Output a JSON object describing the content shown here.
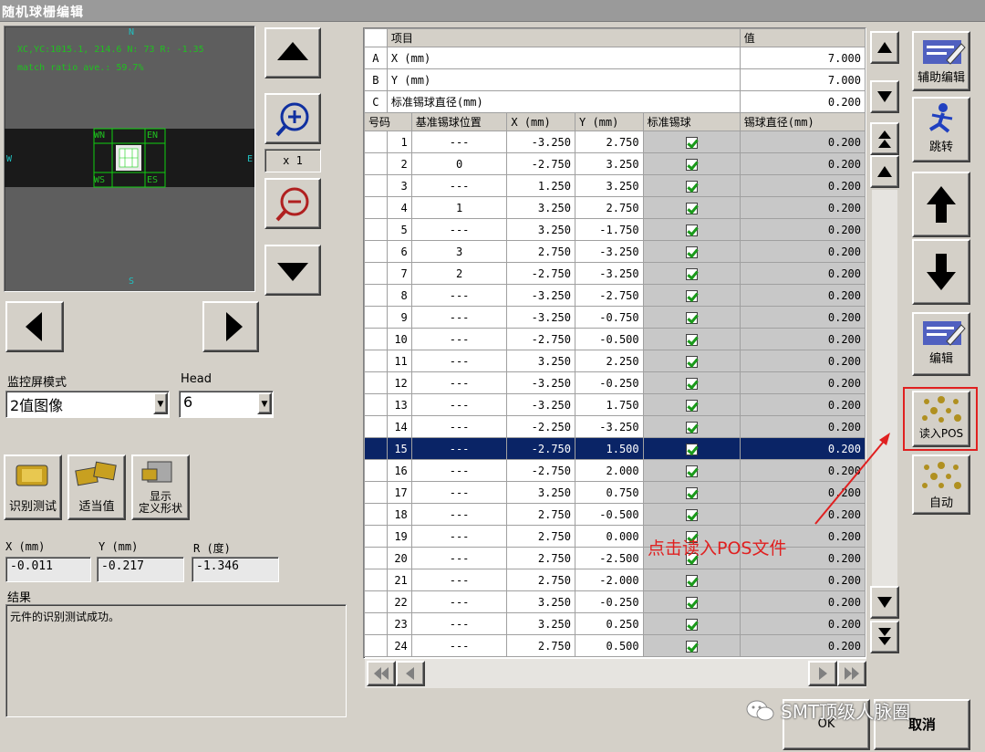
{
  "window": {
    "title": "随机球栅编辑"
  },
  "camera": {
    "info_line": "XC,YC:1015.1, 214.6 N: 73  R: -1.35",
    "match_line": "match ratio ave.: 59.7%",
    "north": "N",
    "south": "S",
    "west": "W",
    "east": "E",
    "tag_wn": "WN",
    "tag_en": "EN",
    "tag_ws": "WS",
    "tag_es": "ES"
  },
  "zoom": {
    "level": "x 1"
  },
  "monitor_mode": {
    "label": "监控屏模式",
    "value": "2值图像"
  },
  "head": {
    "label": "Head",
    "value": "6"
  },
  "tools": {
    "recognize_test": "识别测试",
    "fit_value": "适当值",
    "show_shape_line1": "显示",
    "show_shape_line2": "定义形状"
  },
  "offset": {
    "x_label": "X (mm)",
    "x_value": "-0.011",
    "y_label": "Y (mm)",
    "y_value": "-0.217",
    "r_label": "R (度)",
    "r_value": "-1.346"
  },
  "result": {
    "label": "结果",
    "text": "元件的识别测试成功。"
  },
  "params": {
    "header_item": "项目",
    "header_value": "值",
    "rows": [
      {
        "key": "A",
        "item": "X (mm)",
        "value": "7.000"
      },
      {
        "key": "B",
        "item": "Y (mm)",
        "value": "7.000"
      },
      {
        "key": "C",
        "item": "标准锡球直径(mm)",
        "value": "0.200"
      }
    ]
  },
  "grid": {
    "headers": [
      "号码",
      "基准锡球位置",
      "X (mm)",
      "Y (mm)",
      "标准锡球",
      "锡球直径(mm)"
    ],
    "rows": [
      [
        "1",
        "---",
        "-3.250",
        "2.750",
        "0.200"
      ],
      [
        "2",
        "0",
        "-2.750",
        "3.250",
        "0.200"
      ],
      [
        "3",
        "---",
        "1.250",
        "3.250",
        "0.200"
      ],
      [
        "4",
        "1",
        "3.250",
        "2.750",
        "0.200"
      ],
      [
        "5",
        "---",
        "3.250",
        "-1.750",
        "0.200"
      ],
      [
        "6",
        "3",
        "2.750",
        "-3.250",
        "0.200"
      ],
      [
        "7",
        "2",
        "-2.750",
        "-3.250",
        "0.200"
      ],
      [
        "8",
        "---",
        "-3.250",
        "-2.750",
        "0.200"
      ],
      [
        "9",
        "---",
        "-3.250",
        "-0.750",
        "0.200"
      ],
      [
        "10",
        "---",
        "-2.750",
        "-0.500",
        "0.200"
      ],
      [
        "11",
        "---",
        "3.250",
        "2.250",
        "0.200"
      ],
      [
        "12",
        "---",
        "-3.250",
        "-0.250",
        "0.200"
      ],
      [
        "13",
        "---",
        "-3.250",
        "1.750",
        "0.200"
      ],
      [
        "14",
        "---",
        "-2.250",
        "-3.250",
        "0.200"
      ],
      [
        "15",
        "---",
        "-2.750",
        "1.500",
        "0.200"
      ],
      [
        "16",
        "---",
        "-2.750",
        "2.000",
        "0.200"
      ],
      [
        "17",
        "---",
        "3.250",
        "0.750",
        "0.200"
      ],
      [
        "18",
        "---",
        "2.750",
        "-0.500",
        "0.200"
      ],
      [
        "19",
        "---",
        "2.750",
        "0.000",
        "0.200"
      ],
      [
        "20",
        "---",
        "2.750",
        "-2.500",
        "0.200"
      ],
      [
        "21",
        "---",
        "2.750",
        "-2.000",
        "0.200"
      ],
      [
        "22",
        "---",
        "3.250",
        "-0.250",
        "0.200"
      ],
      [
        "23",
        "---",
        "3.250",
        "0.250",
        "0.200"
      ],
      [
        "24",
        "---",
        "2.750",
        "0.500",
        "0.200"
      ]
    ],
    "selected_row": 15
  },
  "side_buttons": {
    "assist_edit": "辅助编辑",
    "jump": "跳转",
    "edit": "编辑",
    "read_pos": "读入POS",
    "auto": "自动"
  },
  "annotation": {
    "text": "点击读入POS文件",
    "color": "#e02020"
  },
  "bottom": {
    "ok": "OK",
    "cancel": "取消"
  },
  "watermark": {
    "text": "SMT顶级人脉圈"
  }
}
